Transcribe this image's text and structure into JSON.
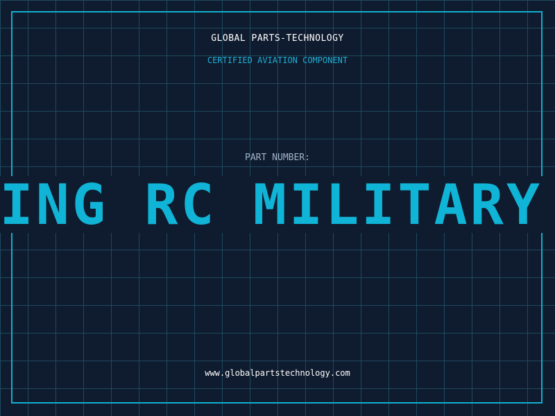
{
  "header": {
    "company": "GLOBAL PARTS-TECHNOLOGY",
    "subtitle": "CERTIFIED AVIATION COMPONENT"
  },
  "part": {
    "label": "PART NUMBER:",
    "number": "HTNING RC MILITARY"
  },
  "footer": {
    "url": "www.globalpartstechnology.com"
  },
  "colors": {
    "background": "#0f1b2e",
    "grid": "#1e4a5e",
    "accent": "#10b4d6",
    "label": "#a3b5c9",
    "text": "#ffffff"
  }
}
